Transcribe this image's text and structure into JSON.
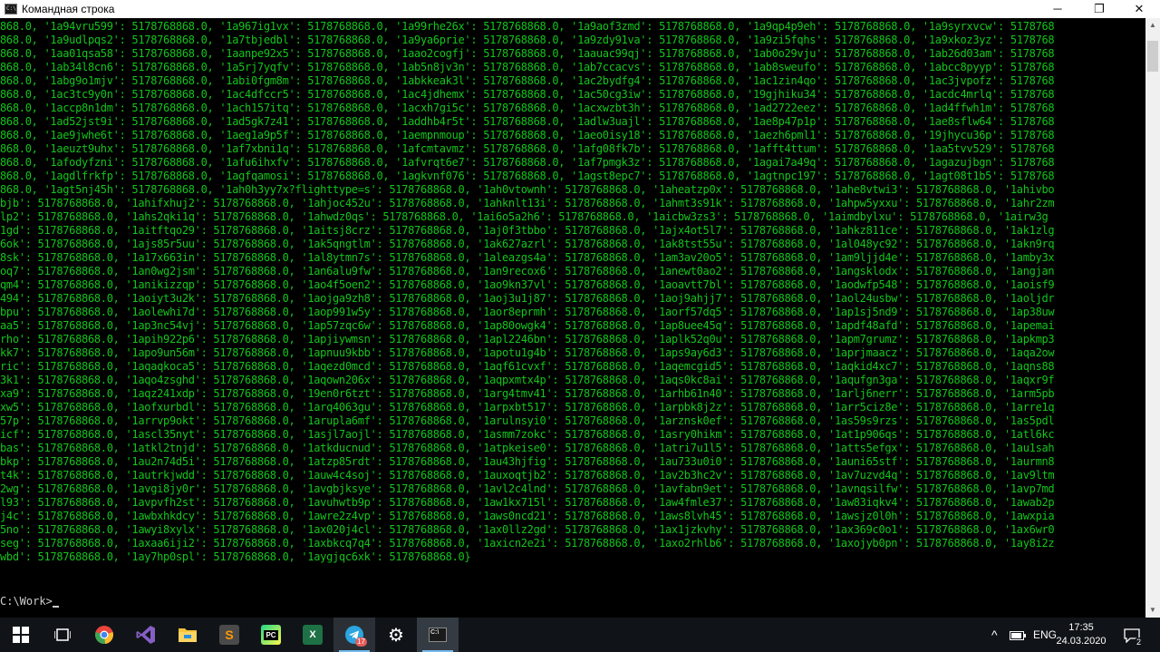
{
  "window": {
    "title": "Командная строка",
    "controls": {
      "minimize": "─",
      "maximize": "❐",
      "close": "✕"
    }
  },
  "console": {
    "lines": [
      "868.0, '1a94vru599': 5178768868.0, '1a967ig1vx': 5178768868.0, '1a99rhe26x': 5178768868.0, '1a9aof3zmd': 5178768868.0, '1a9qp4p9eh': 5178768868.0, '1a9syrxvcw': 5178768",
      "868.0, '1a9udlpqs2': 5178768868.0, '1a7tbjedbl': 5178768868.0, '1a9ya6prie': 5178768868.0, '1a9zdy91va': 5178768868.0, '1a9zi5fqhs': 5178768868.0, '1a9xkoz3yz': 5178768",
      "868.0, '1aa01qsa58': 5178768868.0, '1aanpe92x5': 5178768868.0, '1aao2cogfj': 5178768868.0, '1aauac99qj': 5178768868.0, '1ab0o29vju': 5178768868.0, '1ab26d03am': 5178768",
      "868.0, '1ab34l8cn6': 5178768868.0, '1a5rj7yqfv': 5178768868.0, '1ab5n8jv3n': 5178768868.0, '1ab7ccacvs': 5178768868.0, '1ab8sweufo': 5178768868.0, '1abcc8pyyp': 5178768",
      "868.0, '1abg9o1mjv': 5178768868.0, '1abi0fgm8m': 5178768868.0, '1abkkeak3l': 5178768868.0, '1ac2bydfg4': 5178768868.0, '1ac1zin4qo': 5178768868.0, '1ac3jvpofz': 5178768",
      "868.0, '1ac3tc9y0n': 5178768868.0, '1ac4dfccr5': 5178768868.0, '1ac4jdhemx': 5178768868.0, '1ac50cg3iw': 5178768868.0, '19gjhiku34': 5178768868.0, '1acdc4mrlq': 5178768",
      "868.0, '1accp8n1dm': 5178768868.0, '1ach157itq': 5178768868.0, '1acxh7gi5c': 5178768868.0, '1acxwzbt3h': 5178768868.0, '1ad2722eez': 5178768868.0, '1ad4ffwh1m': 5178768",
      "868.0, '1ad52jst9i': 5178768868.0, '1ad5gk7z41': 5178768868.0, '1addhb4r5t': 5178768868.0, '1adlw3uajl': 5178768868.0, '1ae8p47p1p': 5178768868.0, '1ae8sflw64': 5178768",
      "868.0, '1ae9jwhe6t': 5178768868.0, '1aeg1a9p5f': 5178768868.0, '1aempnmoup': 5178768868.0, '1aeo0isy18': 5178768868.0, '1aezh6pml1': 5178768868.0, '19jhycu36p': 5178768",
      "868.0, '1aeuzt9uhx': 5178768868.0, '1af7xbni1q': 5178768868.0, '1afcmtavmz': 5178768868.0, '1afg08fk7b': 5178768868.0, '1afft4ttum': 5178768868.0, '1aa5tvv529': 5178768",
      "868.0, '1afodyfzni': 5178768868.0, '1afu6ihxfv': 5178768868.0, '1afvrqt6e7': 5178768868.0, '1af7pmgk3z': 5178768868.0, '1agai7a49q': 5178768868.0, '1agazujbgn': 5178768",
      "868.0, '1agdlfrkfp': 5178768868.0, '1agfqamosi': 5178768868.0, '1agkvnf076': 5178768868.0, '1agst8epc7': 5178768868.0, '1agtnpc197': 5178768868.0, '1agt08t1b5': 5178768",
      "868.0, '1agt5nj45h': 5178768868.0, '1ah0h3yy7x?flighttype=s': 5178768868.0, '1ah0vtownh': 5178768868.0, '1aheatzp0x': 5178768868.0, '1ahe8vtwi3': 5178768868.0, '1ahivbo",
      "bjb': 5178768868.0, '1ahifxhuj2': 5178768868.0, '1ahjoc452u': 5178768868.0, '1ahknlt13i': 5178768868.0, '1ahmt3s91k': 5178768868.0, '1ahpw5yxxu': 5178768868.0, '1ahr2zm",
      "lp2': 5178768868.0, '1ahs2qki1q': 5178768868.0, '1ahwdz0qs': 5178768868.0, '1ai6o5a2h6': 5178768868.0, '1aicbw3zs3': 5178768868.0, '1aimdbylxu': 5178768868.0, '1airw3g",
      "1gd': 5178768868.0, '1aitftqo29': 5178768868.0, '1aitsj8crz': 5178768868.0, '1aj0f3tbbo': 5178768868.0, '1ajx4ot5l7': 5178768868.0, '1ahkz811ce': 5178768868.0, '1ak1zlg",
      "6ok': 5178768868.0, '1ajs85r5uu': 5178768868.0, '1ak5qngtlm': 5178768868.0, '1ak627azrl': 5178768868.0, '1ak8tst55u': 5178768868.0, '1al048yc92': 5178768868.0, '1akn9rq",
      "8sk': 5178768868.0, '1a17x663in': 5178768868.0, '1al8ytmn7s': 5178768868.0, '1aleazgs4a': 5178768868.0, '1am3av20o5': 5178768868.0, '1am9ljjd4e': 5178768868.0, '1amby3x",
      "oq7': 5178768868.0, '1an0wg2jsm': 5178768868.0, '1an6alu9fw': 5178768868.0, '1an9recox6': 5178768868.0, '1anewt0ao2': 5178768868.0, '1angsklodx': 5178768868.0, '1angjan",
      "qm4': 5178768868.0, '1anikizzqp': 5178768868.0, '1ao4f5oen2': 5178768868.0, '1ao9kn37vl': 5178768868.0, '1aoavtt7bl': 5178768868.0, '1aodwfp548': 5178768868.0, '1aoisf9",
      "494': 5178768868.0, '1aoiyt3u2k': 5178768868.0, '1aojga9zh8': 5178768868.0, '1aoj3u1j87': 5178768868.0, '1aoj9ahjj7': 5178768868.0, '1aol24usbw': 5178768868.0, '1aoljdr",
      "bpu': 5178768868.0, '1aolewhi7d': 5178768868.0, '1aop991w5y': 5178768868.0, '1aor8eprmh': 5178768868.0, '1aorf57dq5': 5178768868.0, '1ap1sj5nd9': 5178768868.0, '1ap38uw",
      "aa5': 5178768868.0, '1ap3nc54vj': 5178768868.0, '1ap57zqc6w': 5178768868.0, '1ap80owgk4': 5178768868.0, '1ap8uee45q': 5178768868.0, '1apdf48afd': 5178768868.0, '1apemai",
      "rho': 5178768868.0, '1apih922p6': 5178768868.0, '1apjiywmsn': 5178768868.0, '1apl2246bn': 5178768868.0, '1aplk52q0u': 5178768868.0, '1apm7grumz': 5178768868.0, '1apkmp3",
      "kk7': 5178768868.0, '1apo9un56m': 5178768868.0, '1apnuu9kbb': 5178768868.0, '1apotu1g4b': 5178768868.0, '1aps9ay6d3': 5178768868.0, '1aprjmaacz': 5178768868.0, '1aqa2ow",
      "ric': 5178768868.0, '1aqaqkoca5': 5178768868.0, '1aqezd0mcd': 5178768868.0, '1aqf61cvxf': 5178768868.0, '1aqemcgid5': 5178768868.0, '1aqkid4xc7': 5178768868.0, '1aqns88",
      "3k1': 5178768868.0, '1aqo4zsghd': 5178768868.0, '1aqown206x': 5178768868.0, '1aqpxmtx4p': 5178768868.0, '1aqs0kc8ai': 5178768868.0, '1aqufgn3ga': 5178768868.0, '1aqxr9f",
      "xa9': 5178768868.0, '1aqz241xdp': 5178768868.0, '19en0r6tzt': 5178768868.0, '1arg4tmv41': 5178768868.0, '1arhb61n40': 5178768868.0, '1arlj6nerr': 5178768868.0, '1arm5pb",
      "xw5': 5178768868.0, '1aofxurbdl': 5178768868.0, '1arq4063gu': 5178768868.0, '1arpxbt517': 5178768868.0, '1arpbk8j2z': 5178768868.0, '1arr5ciz8e': 5178768868.0, '1arre1q",
      "57p': 5178768868.0, '1arrvp9okt': 5178768868.0, '1arupla6mf': 5178768868.0, '1arulnsyi0': 5178768868.0, '1arznsk0ef': 5178768868.0, '1as59s9rzs': 5178768868.0, '1as5pdl",
      "icf': 5178768868.0, '1ascl35nyt': 5178768868.0, '1asjl7aojl': 5178768868.0, '1asmm7zokc': 5178768868.0, '1asry0hikm': 5178768868.0, '1at1p906qs': 5178768868.0, '1atl6kc",
      "bas': 5178768868.0, '1atkl2tnjd': 5178768868.0, '1atkducnud': 5178768868.0, '1atpkeise0': 5178768868.0, '1atri7u1l5': 5178768868.0, '1atts5efgx': 5178768868.0, '1au1sah",
      "bkp': 5178768868.0, '1au2n74d5i': 5178768868.0, '1atzp85rdt': 5178768868.0, '1au43hjfig': 5178768868.0, '1au733u0i0': 5178768868.0, '1auni65stf': 5178768868.0, '1aurmn8",
      "t4k': 5178768868.0, '1autrkjwdd': 5178768868.0, '1auw4c4soj': 5178768868.0, '1auxoqtjb2': 5178768868.0, '1av2b3hc2v': 5178768868.0, '1av7uzvd4q': 5178768868.0, '1av9ltm",
      "2wg': 5178768868.0, '1avgi8jy0r': 5178768868.0, '1avgbjksye': 5178768868.0, '1avl2c4lnd': 5178768868.0, '1avfabn9et': 5178768868.0, '1avnqsilfw': 5178768868.0, '1avp7md",
      "l93': 5178768868.0, '1avpvfh2st': 5178768868.0, '1avuhwtb9p': 5178768868.0, '1aw1kx715l': 5178768868.0, '1aw4fmle37': 5178768868.0, '1aw83iqkv4': 5178768868.0, '1awab2p",
      "j4c': 5178768868.0, '1awbxhkdcy': 5178768868.0, '1awre2z4vp': 5178768868.0, '1aws0ncd21': 5178768868.0, '1aws8lvh45': 5178768868.0, '1awsjz0l0h': 5178768868.0, '1awxpia",
      "5no': 5178768868.0, '1awyi8xylx': 5178768868.0, '1ax020j4cl': 5178768868.0, '1ax0llz2gd': 5178768868.0, '1ax1jzkvhy': 5178768868.0, '1ax369c0o1': 5178768868.0, '1ax6wr0",
      "seg': 5178768868.0, '1axaa6iji2': 5178768868.0, '1axbkcq7q4': 5178768868.0, '1axicn2e2i': 5178768868.0, '1axo2rhlb6': 5178768868.0, '1axojyb0pn': 5178768868.0, '1ay8i2z",
      "wbd': 5178768868.0, '1ay7hp0spl': 5178768868.0, '1aygjqc6xk': 5178768868.0}"
    ],
    "prompt": "C:\\Work>"
  },
  "scrollbar": {
    "up": "▲",
    "down": "▼"
  },
  "taskbar": {
    "apps": [
      {
        "name": "start-button",
        "glyph": "",
        "color": "#ffffff"
      },
      {
        "name": "task-view-button",
        "glyph": "",
        "color": "#ffffff"
      },
      {
        "name": "chrome-app",
        "glyph": "",
        "color": "#e8453c"
      },
      {
        "name": "visual-studio-app",
        "glyph": "VS",
        "color": "#865fc5"
      },
      {
        "name": "file-explorer-app",
        "glyph": "",
        "color": "#f8c43a"
      },
      {
        "name": "sublime-text-app",
        "glyph": "S",
        "color": "#ff9800"
      },
      {
        "name": "pycharm-app",
        "glyph": "PC",
        "color": "#21d789"
      },
      {
        "name": "excel-app",
        "glyph": "X",
        "color": "#1e7145"
      },
      {
        "name": "telegram-app",
        "glyph": "➤",
        "color": "#2ca5e0",
        "badge": "17"
      },
      {
        "name": "settings-app",
        "glyph": "⚙",
        "color": "#ffffff"
      },
      {
        "name": "cmd-app",
        "glyph": "C:\\",
        "color": "#1a1a1a"
      }
    ],
    "tray": {
      "chevron": "^",
      "language": "ENG",
      "time": "17:35",
      "date": "24.03.2020",
      "notifications_count": "2"
    }
  },
  "colors": {
    "console_text": "#13c51c",
    "console_bg": "#000000",
    "taskbar_bg": "#101418",
    "active_indicator": "#76b9ed"
  }
}
